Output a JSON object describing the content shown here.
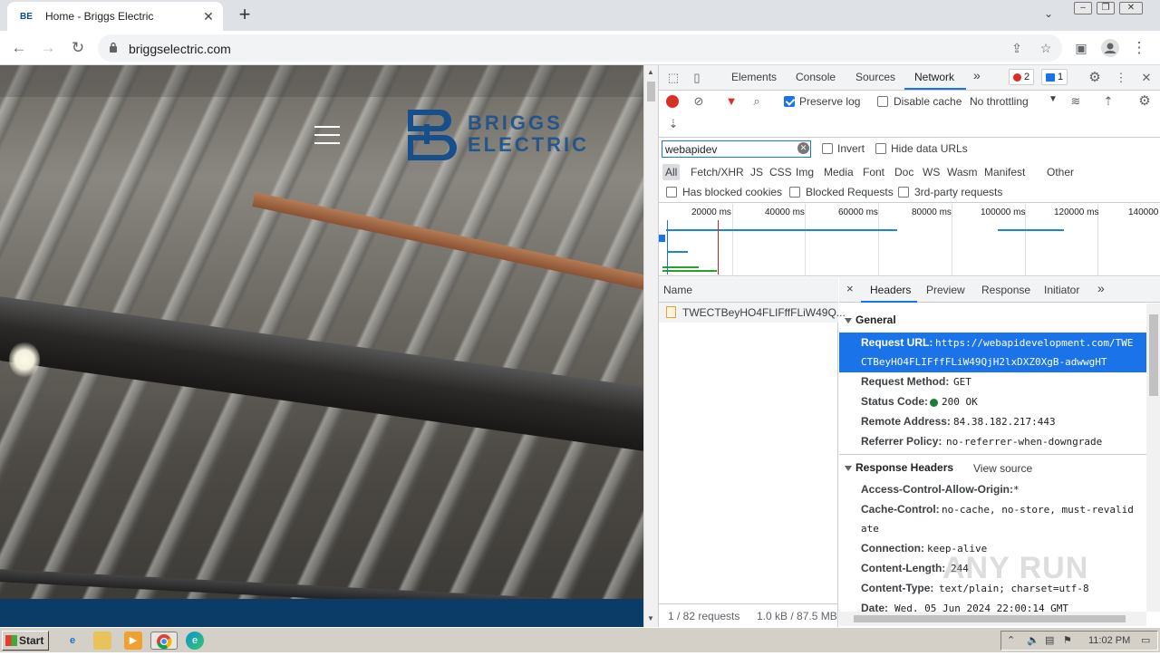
{
  "browser": {
    "tab_title": "Home - Briggs Electric",
    "favicon": "BE",
    "new_tab": "+",
    "url": "briggselectric.com"
  },
  "page": {
    "logo_line1": "BRIGGS",
    "logo_line2": "ELECTRIC"
  },
  "devtools": {
    "tabs": [
      "Elements",
      "Console",
      "Sources",
      "Network"
    ],
    "active_tab": "Network",
    "more": "»",
    "error_count": "2",
    "message_count": "1",
    "toolbar": {
      "preserve_log": "Preserve log",
      "preserve_log_checked": true,
      "disable_cache": "Disable cache",
      "disable_cache_checked": false,
      "throttling": "No throttling"
    },
    "filter": {
      "value": "webapidev",
      "invert": "Invert",
      "hide_data_urls": "Hide data URLs",
      "types": [
        "All",
        "Fetch/XHR",
        "JS",
        "CSS",
        "Img",
        "Media",
        "Font",
        "Doc",
        "WS",
        "Wasm",
        "Manifest",
        "Other"
      ],
      "has_blocked_cookies": "Has blocked cookies",
      "blocked_requests": "Blocked Requests",
      "third_party": "3rd-party requests"
    },
    "overview": {
      "ticks": [
        "20000 ms",
        "40000 ms",
        "60000 ms",
        "80000 ms",
        "100000 ms",
        "120000 ms",
        "140000"
      ]
    },
    "requests": {
      "column_name": "Name",
      "rows": [
        "TWECTBeyHO4FLIFffFLiW49Q..."
      ],
      "summary": "1 / 82 requests",
      "transfer": "1.0 kB / 87.5 MB"
    },
    "details": {
      "close": "×",
      "tabs": [
        "Headers",
        "Preview",
        "Response",
        "Initiator"
      ],
      "active_tab": "Headers",
      "more": "»",
      "general_title": "General",
      "request_url_key": "Request URL:",
      "request_url_line1": "https://webapidevelopment.com/TWE",
      "request_url_line2": "CTBeyHO4FLIFffFLiW49QjH2lxDXZ0XgB-adwwgHT",
      "request_method_key": "Request Method:",
      "request_method": "GET",
      "status_code_key": "Status Code:",
      "status_code": "200 OK",
      "remote_address_key": "Remote Address:",
      "remote_address": "84.38.182.217:443",
      "referrer_policy_key": "Referrer Policy:",
      "referrer_policy": "no-referrer-when-downgrade",
      "response_headers_title": "Response Headers",
      "view_source": "View source",
      "acao_key": "Access-Control-Allow-Origin:",
      "acao": "*",
      "cache_control_key": "Cache-Control:",
      "cache_control_line1": "no-cache, no-store, must-revalid",
      "cache_control_line2": "ate",
      "connection_key": "Connection:",
      "connection": "keep-alive",
      "content_length_key": "Content-Length:",
      "content_length": "244",
      "content_type_key": "Content-Type:",
      "content_type": "text/plain; charset=utf-8",
      "date_key": "Date:",
      "date": "Wed, 05 Jun 2024 22:00:14 GMT"
    }
  },
  "watermark": "ANY RUN",
  "taskbar": {
    "start": "Start",
    "clock": "11:02 PM"
  }
}
